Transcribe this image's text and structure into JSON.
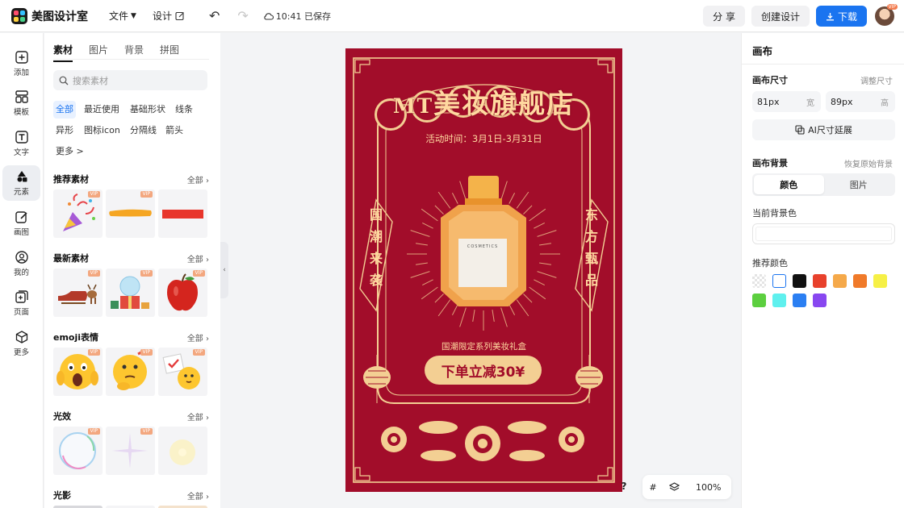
{
  "topbar": {
    "app_name": "美图设计室",
    "file_menu": "文件",
    "design_menu": "设计",
    "save_status": "10:41 已保存",
    "share": "分 享",
    "create_design": "创建设计",
    "download": "下载",
    "avatar_badge": "VIP"
  },
  "rail": [
    {
      "label": "添加",
      "icon": "plus-square-icon"
    },
    {
      "label": "模板",
      "icon": "template-icon"
    },
    {
      "label": "文字",
      "icon": "text-icon"
    },
    {
      "label": "元素",
      "icon": "element-icon",
      "active": true
    },
    {
      "label": "画图",
      "icon": "draw-icon"
    },
    {
      "label": "我的",
      "icon": "user-icon"
    },
    {
      "label": "页面",
      "icon": "page-icon"
    },
    {
      "label": "更多",
      "icon": "cube-icon"
    }
  ],
  "panel": {
    "tabs": [
      "素材",
      "图片",
      "背景",
      "拼图"
    ],
    "search_placeholder": "搜索素材",
    "chips": [
      "全部",
      "最近使用",
      "基础形状",
      "线条",
      "异形",
      "图标icon",
      "分隔线",
      "箭头",
      "更多 >"
    ],
    "sections": [
      {
        "title": "推荐素材",
        "all": "全部"
      },
      {
        "title": "最新素材",
        "all": "全部"
      },
      {
        "title": "emoji表情",
        "all": "全部"
      },
      {
        "title": "光效",
        "all": "全部"
      },
      {
        "title": "光影",
        "all": "全部"
      }
    ],
    "vip_badge": "VIP"
  },
  "poster": {
    "title_prefix": "MT",
    "title": "美妆旗舰店",
    "date": "活动时间：3月1日-3月31日",
    "left_text": [
      "国",
      "潮",
      "来",
      "袭"
    ],
    "right_text": [
      "东",
      "方",
      "甄",
      "品"
    ],
    "bottle_label": "COSMETICS",
    "subtitle": "国潮限定系列美妆礼盒",
    "cta": "下单立减30¥",
    "colors": {
      "background": "#a20d2a",
      "gold": "#f3cf93"
    }
  },
  "canvas_tools": {
    "help": "?",
    "zoom": "100%"
  },
  "right_panel": {
    "title": "画布",
    "size_label": "画布尺寸",
    "size_link": "调整尺寸",
    "width_value": "81px",
    "width_unit": "宽",
    "height_value": "89px",
    "height_unit": "高",
    "ai_extend": "AI尺寸延展",
    "bg_label": "画布背景",
    "bg_reset": "恢复原始背景",
    "bg_tabs": [
      "颜色",
      "图片"
    ],
    "current_bg_label": "当前背景色",
    "recommend_label": "推荐颜色",
    "swatches": [
      "transparent",
      "#ffffff",
      "#111111",
      "#e8412c",
      "#f5a94a",
      "#f07a2a",
      "#f6f046",
      "#5ccf3f",
      "#5ff0ee",
      "#2b7ff2",
      "#8847f0"
    ]
  }
}
